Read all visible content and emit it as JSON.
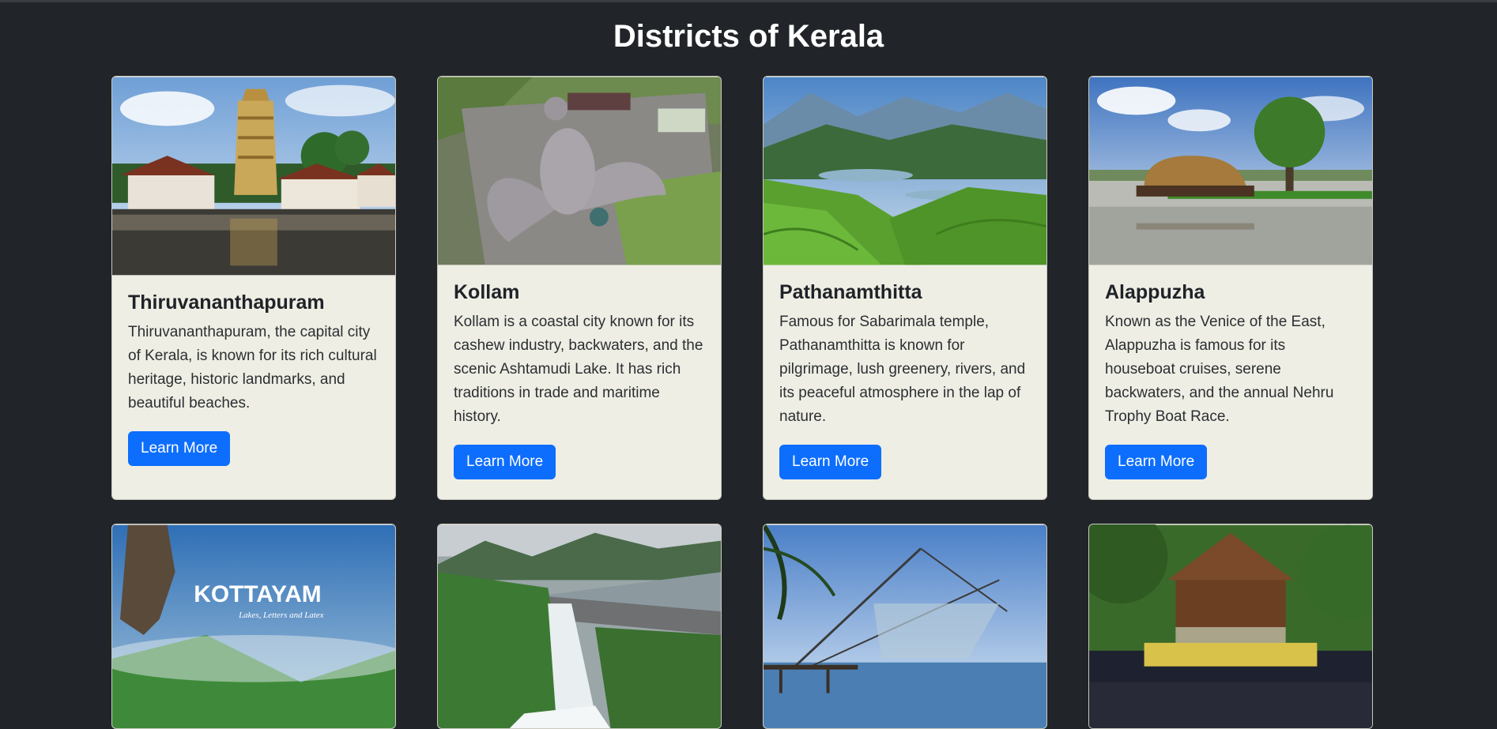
{
  "page": {
    "title": "Districts of Kerala"
  },
  "cards": [
    {
      "name": "Thiruvananthapuram",
      "description": "Thiruvananthapuram, the capital city of Kerala, is known for its rich cultural heritage, historic landmarks, and beautiful beaches.",
      "button": "Learn More",
      "image": "temple-pond-image"
    },
    {
      "name": "Kollam",
      "description": "Kollam is a coastal city known for its cashew industry, backwaters, and the scenic Ashtamudi Lake. It has rich traditions in trade and maritime history.",
      "button": "Learn More",
      "image": "bird-sculpture-image"
    },
    {
      "name": "Pathanamthitta",
      "description": "Famous for Sabarimala temple, Pathanamthitta is known for pilgrimage, lush greenery, rivers, and its peaceful atmosphere in the lap of nature.",
      "button": "Learn More",
      "image": "tea-hills-image"
    },
    {
      "name": "Alappuzha",
      "description": "Known as the Venice of the East, Alappuzha is famous for its houseboat cruises, serene backwaters, and the annual Nehru Trophy Boat Race.",
      "button": "Learn More",
      "image": "houseboat-image"
    }
  ],
  "row2_images": [
    {
      "image": "kottayam-poster-image",
      "overlay_title": "KOTTAYAM",
      "overlay_subtitle": "Lakes, Letters and Latex"
    },
    {
      "image": "dam-image"
    },
    {
      "image": "chinese-fishing-net-image"
    },
    {
      "image": "temple-festival-image"
    }
  ],
  "colors": {
    "background": "#212529",
    "card": "#efeee4",
    "button": "#0d6efd"
  }
}
